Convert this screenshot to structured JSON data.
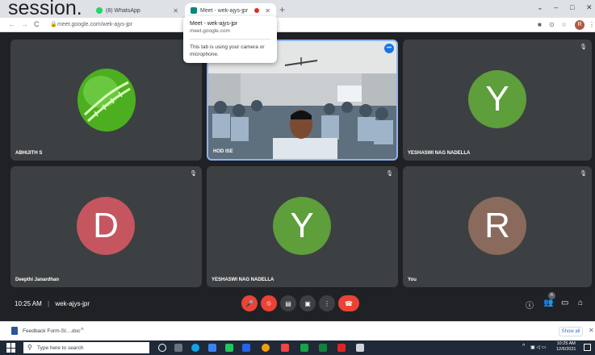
{
  "overlay_text": "session.",
  "tabs": [
    {
      "label": "(8) WhatsApp"
    },
    {
      "label": "Meet - wek-ajys-jpr"
    }
  ],
  "browser": {
    "url": "meet.google.com/wek-ajys-jpr"
  },
  "tooltip": {
    "title": "Meet - wek-ajys-jpr",
    "host": "meet.google.com",
    "message": "This tab is using your camera or microphone."
  },
  "participants": [
    {
      "name": "ABHIJITH S",
      "avatar_type": "photo-dna"
    },
    {
      "name": "HOD ISE",
      "avatar_type": "video"
    },
    {
      "name": "YESHASWI NAG NADELLA",
      "initial": "Y",
      "color": "#5e9e3b"
    },
    {
      "name": "Deepthi Janardhan",
      "initial": "D",
      "color": "#c5565f"
    },
    {
      "name": "YESHASWI NAG NADELLA",
      "initial": "Y",
      "color": "#5e9e3b"
    },
    {
      "name": "You",
      "initial": "R",
      "color": "#8a6a5c"
    }
  ],
  "meeting": {
    "time": "10:25 AM",
    "code": "wek-ajys-jpr",
    "people_count": "6"
  },
  "download": {
    "filename": "Feedback Form-SI....doc",
    "show_all": "Show all"
  },
  "taskbar": {
    "search_placeholder": "Type here to search",
    "time": "10:25 AM",
    "date": "12/6/2021"
  },
  "colors": {
    "meet_bg": "#202124",
    "tile_bg": "#3c4043",
    "hangup_red": "#ea4335",
    "active_border": "#8ab4f8"
  }
}
